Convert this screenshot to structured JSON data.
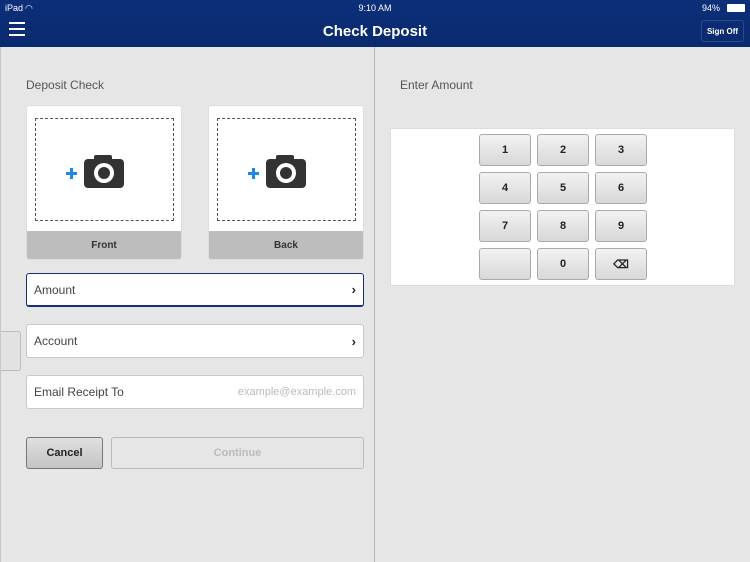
{
  "status": {
    "device": "iPad",
    "time": "9:10 AM",
    "battery": "94%"
  },
  "header": {
    "title": "Check Deposit",
    "sign_off": "Sign Off"
  },
  "left": {
    "section_title": "Deposit Check",
    "front_label": "Front",
    "back_label": "Back",
    "amount_label": "Amount",
    "account_label": "Account",
    "email_label": "Email Receipt To",
    "email_placeholder": "example@example.com",
    "cancel": "Cancel",
    "continue": "Continue"
  },
  "right": {
    "section_title": "Enter Amount",
    "keys": [
      "1",
      "2",
      "3",
      "4",
      "5",
      "6",
      "7",
      "8",
      "9",
      "",
      "0",
      "⌫"
    ]
  },
  "colors": {
    "header": "#0a2a6e",
    "plus": "#1e88e5"
  }
}
